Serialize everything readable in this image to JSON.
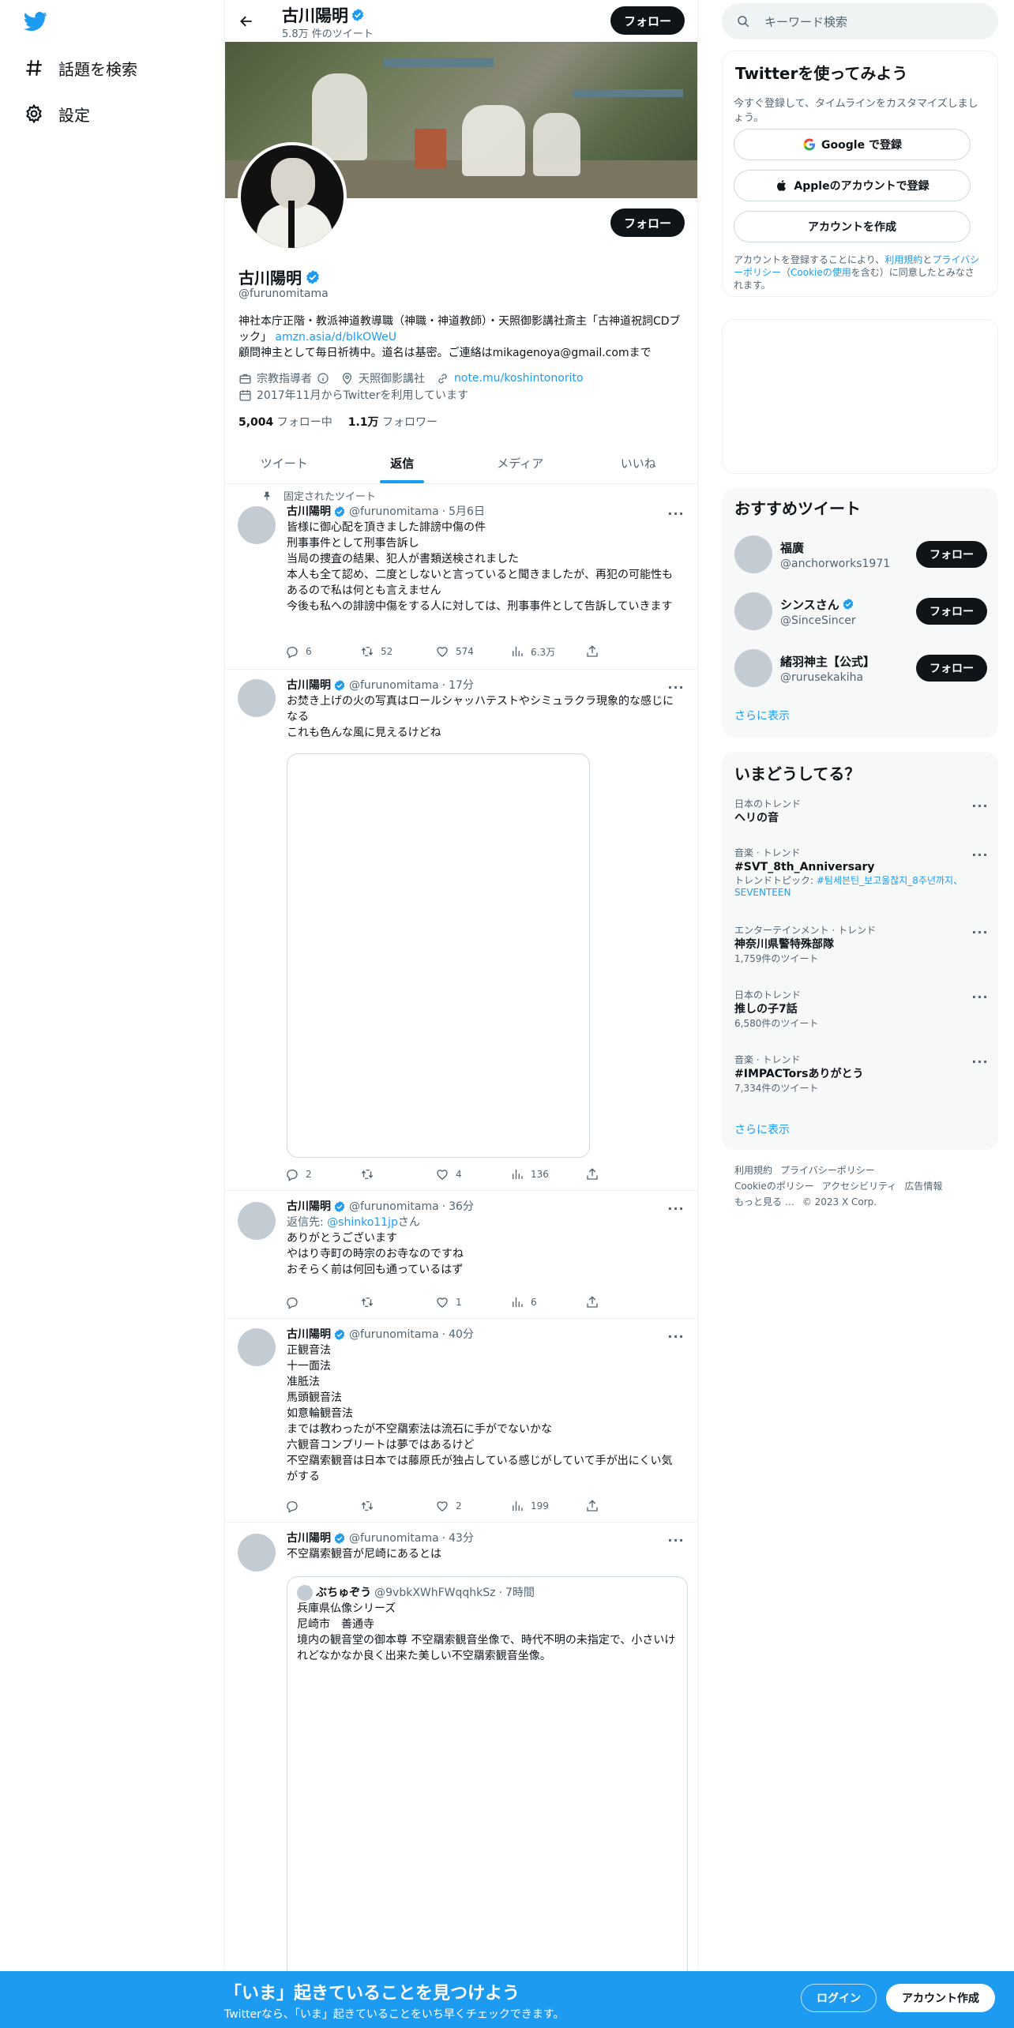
{
  "nav": {
    "explore_label": "話題を検索",
    "settings_label": "設定"
  },
  "header": {
    "name": "古川陽明",
    "tweet_count": "5.8万 件のツイート",
    "follow_label": "フォロー"
  },
  "profile": {
    "name": "古川陽明",
    "handle": "@furunomitama",
    "follow_label": "フォロー",
    "bio_line1": "神社本庁正階・教派神道教導職（神職・神道教師）・天照御影講社斎主「古神道祝詞CDブック」",
    "bio_link": "amzn.asia/d/bIkOWeU",
    "bio_line2": "顧問神主として毎日祈祷中。道名は基密。ご連絡はmikagenoya@gmail.comまで",
    "category": "宗教指導者",
    "location": "天照御影講社",
    "website": "note.mu/koshintonorito",
    "joined": "2017年11月からTwitterを利用しています",
    "following_count": "5,004",
    "following_label": "フォロー中",
    "followers_count": "1.1万",
    "followers_label": "フォロワー"
  },
  "tabs": [
    "ツイート",
    "返信",
    "メディア",
    "いいね"
  ],
  "tweets": [
    {
      "pinned_label": "固定されたツイート",
      "name": "古川陽明",
      "handle": "@furunomitama",
      "time": "5月6日",
      "lines": [
        "皆様に御心配を頂きました誹謗中傷の件",
        "刑事事件として刑事告訴し",
        "当局の捜査の結果、犯人が書類送検されました",
        "本人も全て認め、二度としないと言っていると聞きましたが、再犯の可能性もあるので私は何とも言えません",
        "今後も私への誹謗中傷をする人に対しては、刑事事件として告訴していきます"
      ],
      "reply": "6",
      "retweet": "52",
      "like": "574",
      "views": "6.3万"
    },
    {
      "name": "古川陽明",
      "handle": "@furunomitama",
      "time": "17分",
      "lines": [
        "お焚き上げの火の写真はロールシャッハテストやシミュラクラ現象的な感じになる",
        "これも色んな風に見えるけどね"
      ],
      "reply": "2",
      "retweet": "",
      "like": "4",
      "views": "136"
    },
    {
      "name": "古川陽明",
      "handle": "@furunomitama",
      "time": "36分",
      "reply_to_prefix": "返信先: ",
      "reply_to_handle": "@shinko11jp",
      "reply_to_suffix": "さん",
      "lines": [
        "ありがとうございます",
        "やはり寺町の時宗のお寺なのですね",
        "おそらく前は何回も通っているはず"
      ],
      "reply": "",
      "retweet": "",
      "like": "1",
      "views": "6"
    },
    {
      "name": "古川陽明",
      "handle": "@furunomitama",
      "time": "40分",
      "lines": [
        "正観音法",
        "十一面法",
        "准胝法",
        "馬頭観音法",
        "如意輪観音法",
        "までは教わったが不空羂索法は流石に手がでないかな",
        "六観音コンプリートは夢ではあるけど",
        "不空羂索観音は日本では藤原氏が独占している感じがしていて手が出にくい気がする"
      ],
      "reply": "",
      "retweet": "",
      "like": "2",
      "views": "199"
    },
    {
      "name": "古川陽明",
      "handle": "@furunomitama",
      "time": "43分",
      "lines": [
        "不空羂索観音が尼崎にあるとは"
      ],
      "quote": {
        "name": "ぶちゅぞう",
        "handle": "@9vbkXWhFWqqhkSz",
        "time": "7時間",
        "lines": [
          "兵庫県仏像シリーズ",
          "尼崎市　善通寺",
          "境内の観音堂の御本尊 不空羂索観音坐像で、時代不明の未指定で、小さいけれどなかなか良く出来た美しい不空羂索観音坐像。"
        ]
      }
    }
  ],
  "right": {
    "search_placeholder": "キーワード検索",
    "signup": {
      "title": "Twitterを使ってみよう",
      "subtitle": "今すぐ登録して、タイムラインをカスタマイズしましょう。",
      "google": "Google で登録",
      "apple": "Appleのアカウントで登録",
      "create": "アカウントを作成",
      "legal_prefix": "アカウントを登録することにより、",
      "legal_terms": "利用規約",
      "legal_and": "と",
      "legal_privacy": "プライバシーポリシー",
      "legal_mid": "（",
      "legal_cookie": "Cookieの使用",
      "legal_suffix": "を含む）に同意したとみなされます。"
    },
    "recommend": {
      "title": "おすすめツイート",
      "accounts": [
        {
          "name": "福廣",
          "handle": "@anchorworks1971",
          "verified": false
        },
        {
          "name": "シンスさん",
          "handle": "@SinceSincer",
          "verified": true
        },
        {
          "name": "緒羽神主【公式】",
          "handle": "@rurusekakiha",
          "verified": false
        }
      ],
      "follow_label": "フォロー",
      "show_more": "さらに表示"
    },
    "trends": {
      "title": "いまどうしてる？",
      "items": [
        {
          "category": "日本のトレンド",
          "name": "ヘリの音",
          "count": ""
        },
        {
          "category": "音楽 · トレンド",
          "name": "#SVT_8th_Anniversary",
          "topic_prefix": "トレンドトピック: ",
          "topic": "#팀세븐틴_보고울찮지_8주년까지、SEVENTEEN",
          "count": ""
        },
        {
          "category": "エンターテインメント · トレンド",
          "name": "神奈川県警特殊部隊",
          "count": "1,759件のツイート"
        },
        {
          "category": "日本のトレンド",
          "name": "推しの子7話",
          "count": "6,580件のツイート"
        },
        {
          "category": "音楽 · トレンド",
          "name": "#IMPACTorsありがとう",
          "count": "7,334件のツイート"
        }
      ],
      "show_more": "さらに表示"
    },
    "footer": [
      "利用規約",
      "プライバシーポリシー",
      "Cookieのポリシー",
      "アクセシビリティ",
      "広告情報",
      "もっと見る …",
      "© 2023 X Corp."
    ]
  },
  "bottom": {
    "title": "「いま」起きていることを見つけよう",
    "subtitle": "Twitterなら、「いま」起きていることをいち早くチェックできます。",
    "login": "ログイン",
    "signup": "アカウント作成"
  },
  "colors": {
    "accent": "#1d9bf0",
    "text": "#0f1419",
    "muted": "#536471",
    "button_dark": "#0f1419"
  }
}
